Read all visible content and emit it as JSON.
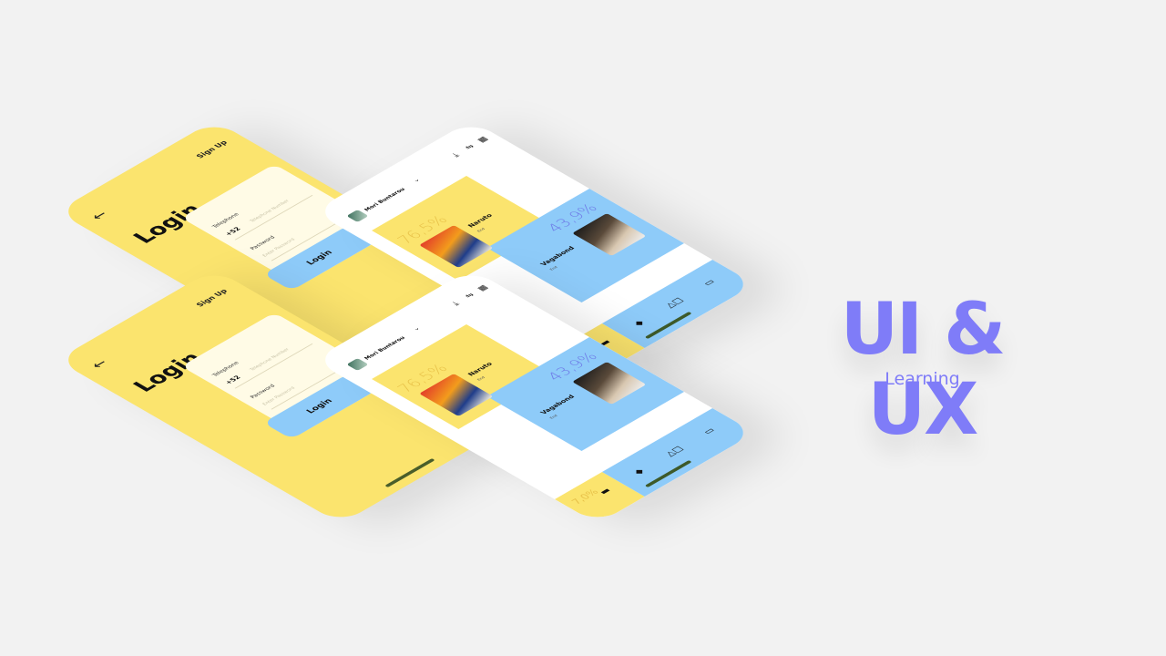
{
  "headline": {
    "title": "UI & UX",
    "subtitle": "Learning"
  },
  "login_screen": {
    "back_icon": "arrow-left-icon",
    "signup_label": "Sign Up",
    "title": "Login",
    "telephone_label": "Telephone",
    "country_code": "+52",
    "telephone_placeholder": "Telephone Number",
    "password_label": "Password",
    "password_placeholder": "Enter Password",
    "login_button": "Login"
  },
  "dashboard_screen": {
    "user_name": "Mori Buntarou",
    "cards": [
      {
        "percent": "76,5%",
        "title": "Naruto",
        "subtitle": "End"
      },
      {
        "percent": "43,9%",
        "title": "Vagabond",
        "subtitle": "End"
      }
    ],
    "bottom_percent": "7,0%",
    "colors": {
      "yellow": "#fbe46e",
      "blue": "#8ecbf9",
      "accent": "#7f7cf8"
    }
  }
}
